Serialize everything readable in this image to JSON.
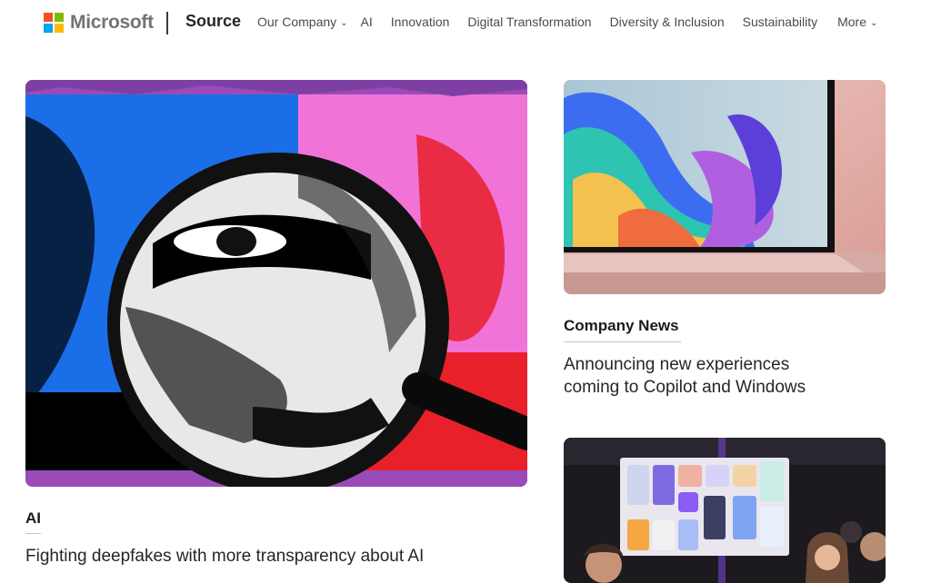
{
  "header": {
    "brand": "Microsoft",
    "site_name": "Source",
    "logo_colors": [
      "#f25022",
      "#7fba00",
      "#00a4ef",
      "#ffb900"
    ],
    "nav": [
      {
        "label": "Our Company",
        "dropdown": true
      },
      {
        "label": "AI",
        "dropdown": false
      },
      {
        "label": "Innovation",
        "dropdown": false
      },
      {
        "label": "Digital Transformation",
        "dropdown": false
      },
      {
        "label": "Diversity & Inclusion",
        "dropdown": false
      },
      {
        "label": "Sustainability",
        "dropdown": false
      },
      {
        "label": "More",
        "dropdown": true
      }
    ]
  },
  "stories": {
    "featured": {
      "category": "AI",
      "headline": "Fighting deepfakes with more transparency about AI",
      "image": "magnifying-glass-over-face-illustration"
    },
    "side_top": {
      "category": "Company News",
      "headline": "Announcing new experiences coming to Copilot and Windows",
      "image": "laptop-with-colorful-bloom-wallpaper"
    },
    "side_bottom": {
      "image": "people-in-front-of-app-display-screen"
    }
  }
}
